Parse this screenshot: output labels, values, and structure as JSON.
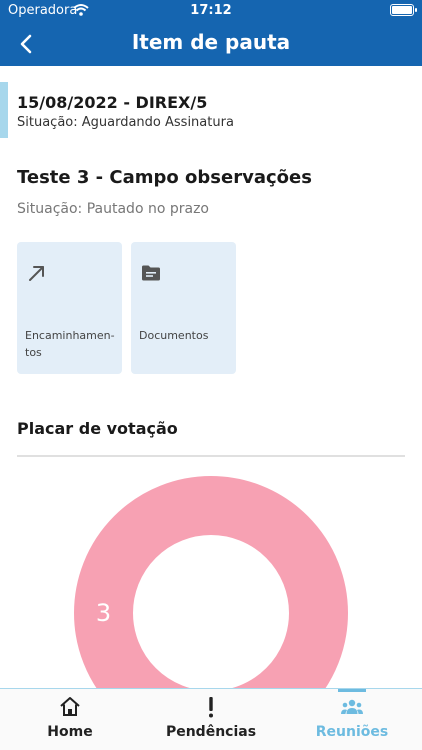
{
  "status_bar": {
    "carrier": "Operadora",
    "time": "17:12"
  },
  "header": {
    "title": "Item de pauta"
  },
  "meeting": {
    "title": "15/08/2022 - DIREX/5",
    "status": "Situação: Aguardando Assinatura"
  },
  "item": {
    "title": "Teste 3 - Campo observações",
    "status": "Situação: Pautado no prazo"
  },
  "tiles": [
    {
      "label": "Encaminhamen-tos",
      "icon": "arrow-up-right-icon"
    },
    {
      "label": "Documentos",
      "icon": "folder-icon"
    }
  ],
  "voting": {
    "title": "Placar de votação"
  },
  "chart_data": {
    "type": "pie",
    "donut": true,
    "slices": [
      {
        "value": 3,
        "color": "#f7a1b3"
      }
    ],
    "labels": [
      "3"
    ]
  },
  "tabs": [
    {
      "label": "Home",
      "icon": "home-icon",
      "active": false
    },
    {
      "label": "Pendências",
      "icon": "exclamation-icon",
      "active": false
    },
    {
      "label": "Reuniões",
      "icon": "people-icon",
      "active": true
    }
  ],
  "colors": {
    "brand": "#1565b0",
    "accent": "#6dbbe0",
    "tile": "#e3eef8",
    "slice": "#f7a1b3"
  }
}
